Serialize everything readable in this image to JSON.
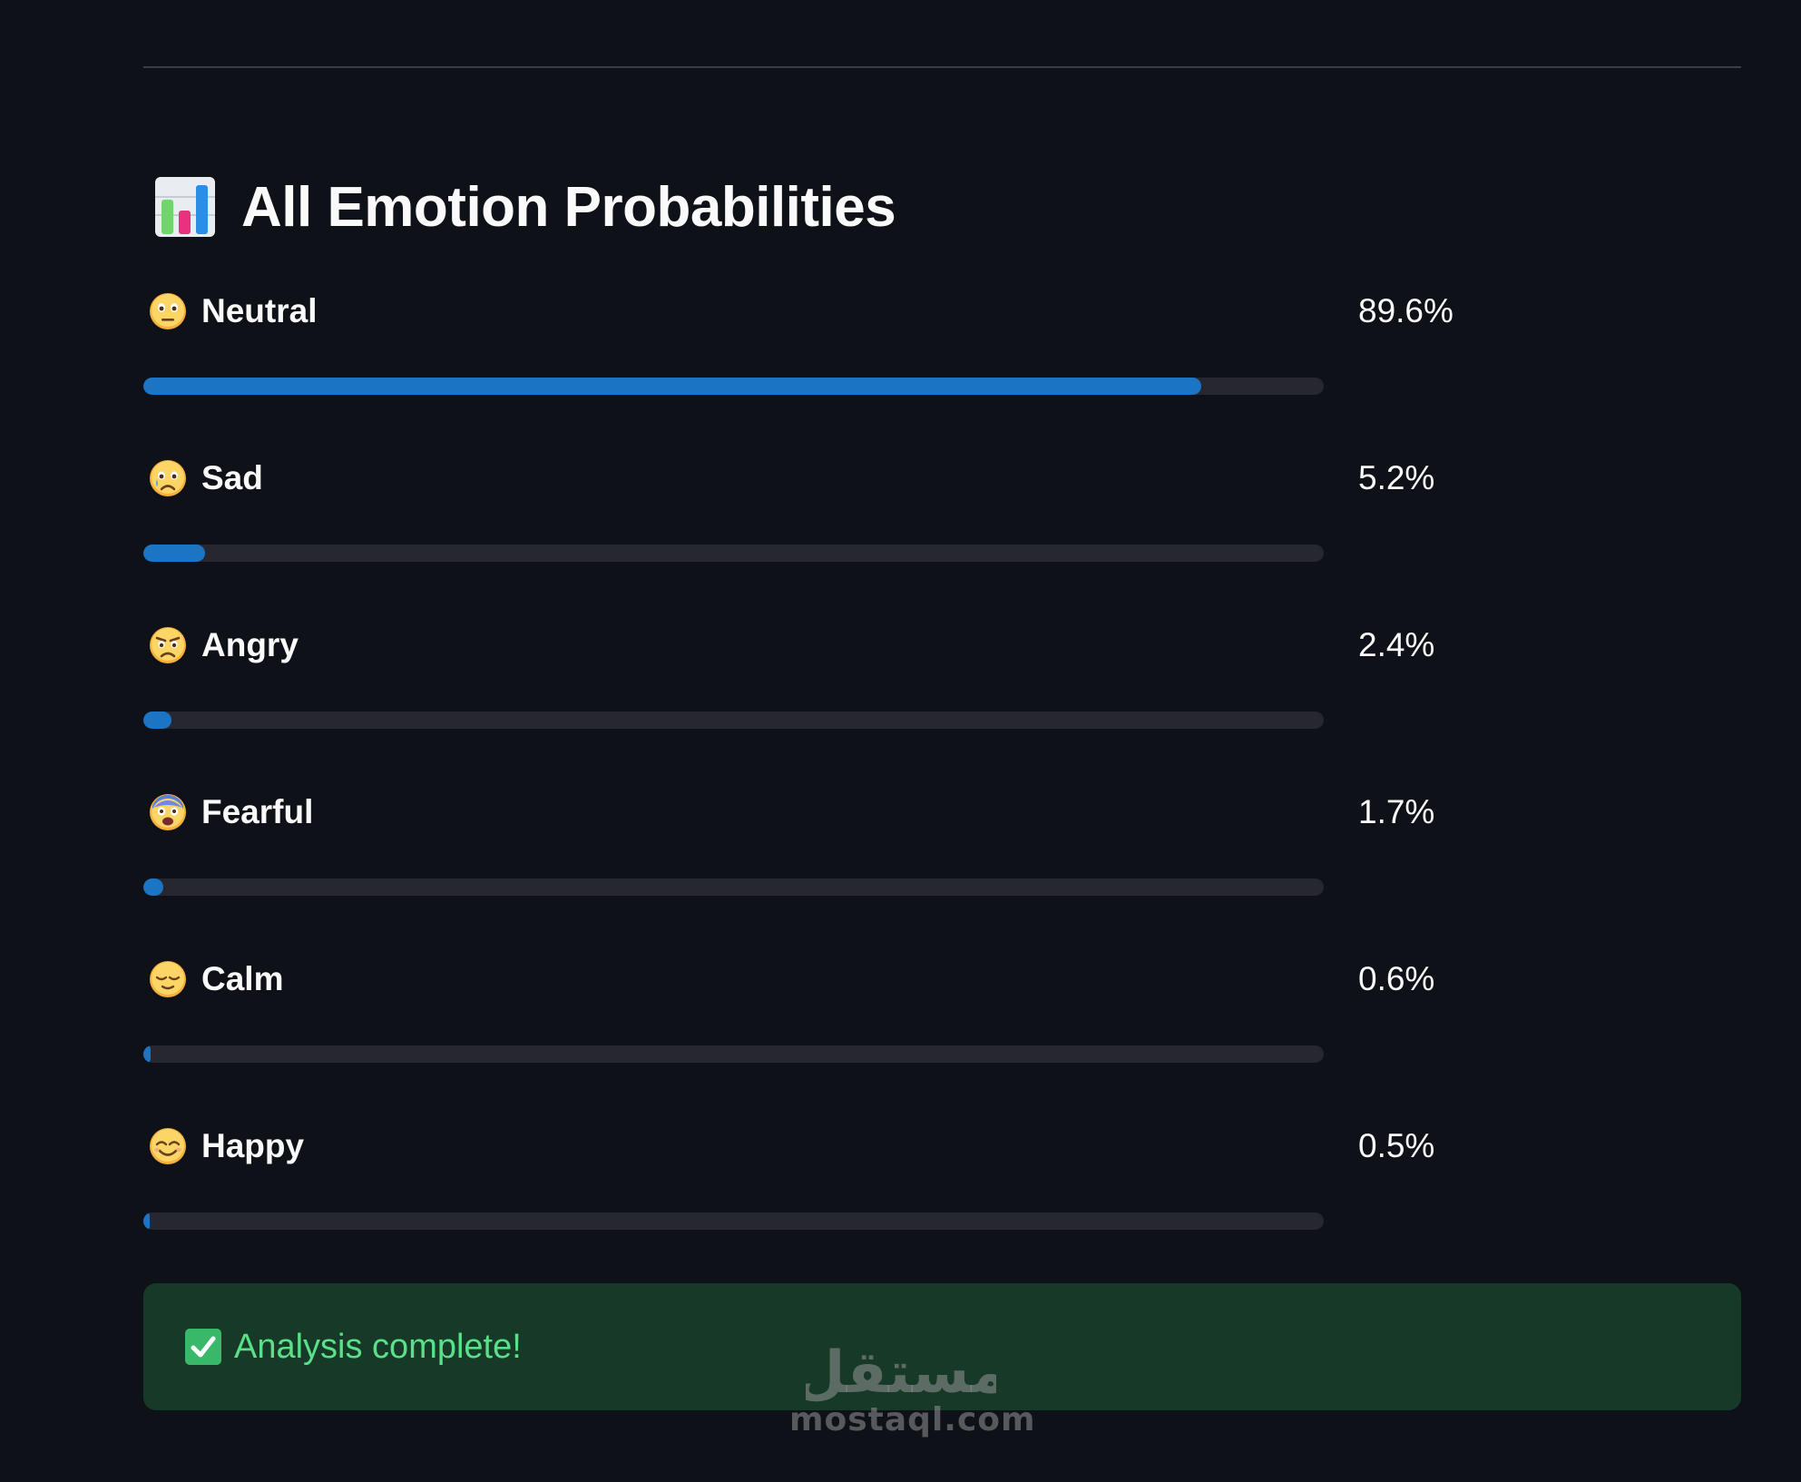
{
  "header": {
    "title": "All Emotion Probabilities",
    "icon": "bar-chart-icon"
  },
  "emotions": [
    {
      "label": "Neutral",
      "percent_text": "89.6%",
      "value": 0.896,
      "emoji": "neutral-face-icon"
    },
    {
      "label": "Sad",
      "percent_text": "5.2%",
      "value": 0.052,
      "emoji": "sad-face-icon"
    },
    {
      "label": "Angry",
      "percent_text": "2.4%",
      "value": 0.024,
      "emoji": "angry-face-icon"
    },
    {
      "label": "Fearful",
      "percent_text": "1.7%",
      "value": 0.017,
      "emoji": "fearful-face-icon"
    },
    {
      "label": "Calm",
      "percent_text": "0.6%",
      "value": 0.006,
      "emoji": "relieved-face-icon"
    },
    {
      "label": "Happy",
      "percent_text": "0.5%",
      "value": 0.005,
      "emoji": "smiling-face-icon"
    }
  ],
  "status": {
    "message": "Analysis complete!",
    "icon": "check-mark-icon"
  },
  "watermark": {
    "logo_text": "مستقل",
    "text": "mostaql.com"
  },
  "colors": {
    "background": "#0e1117",
    "bar_fill": "#1c74c4",
    "bar_track": "#262730",
    "success_bg": "#173928",
    "success_text": "#5ae088"
  }
}
